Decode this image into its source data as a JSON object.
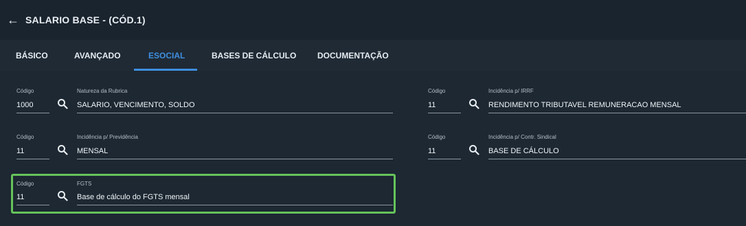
{
  "header": {
    "title": "SALARIO BASE - (CÓD.1)"
  },
  "tabs": [
    {
      "label": "BÁSICO"
    },
    {
      "label": "AVANÇADO"
    },
    {
      "label": "ESOCIAL"
    },
    {
      "label": "BASES DE CÁLCULO"
    },
    {
      "label": "DOCUMENTAÇÃO"
    }
  ],
  "fields": {
    "natureza": {
      "code_label": "Código",
      "code_value": "1000",
      "label": "Natureza da Rubrica",
      "value": "SALARIO, VENCIMENTO, SOLDO"
    },
    "previdencia": {
      "code_label": "Código",
      "code_value": "11",
      "label": "Incidência p/ Previdência",
      "value": "MENSAL"
    },
    "fgts": {
      "code_label": "Código",
      "code_value": "11",
      "label": "FGTS",
      "value": "Base de cálculo do FGTS mensal"
    },
    "irrf": {
      "code_label": "Código",
      "code_value": "11",
      "label": "Incidência p/ IRRF",
      "value": "RENDIMENTO TRIBUTAVEL REMUNERACAO MENSAL"
    },
    "sindical": {
      "code_label": "Código",
      "code_value": "11",
      "label": "Incidência p/ Contr. Sindical",
      "value": "BASE DE CÁLCULO"
    }
  },
  "colors": {
    "accent": "#3f8fe0",
    "highlight": "#66c45a",
    "background": "#1c2731"
  }
}
